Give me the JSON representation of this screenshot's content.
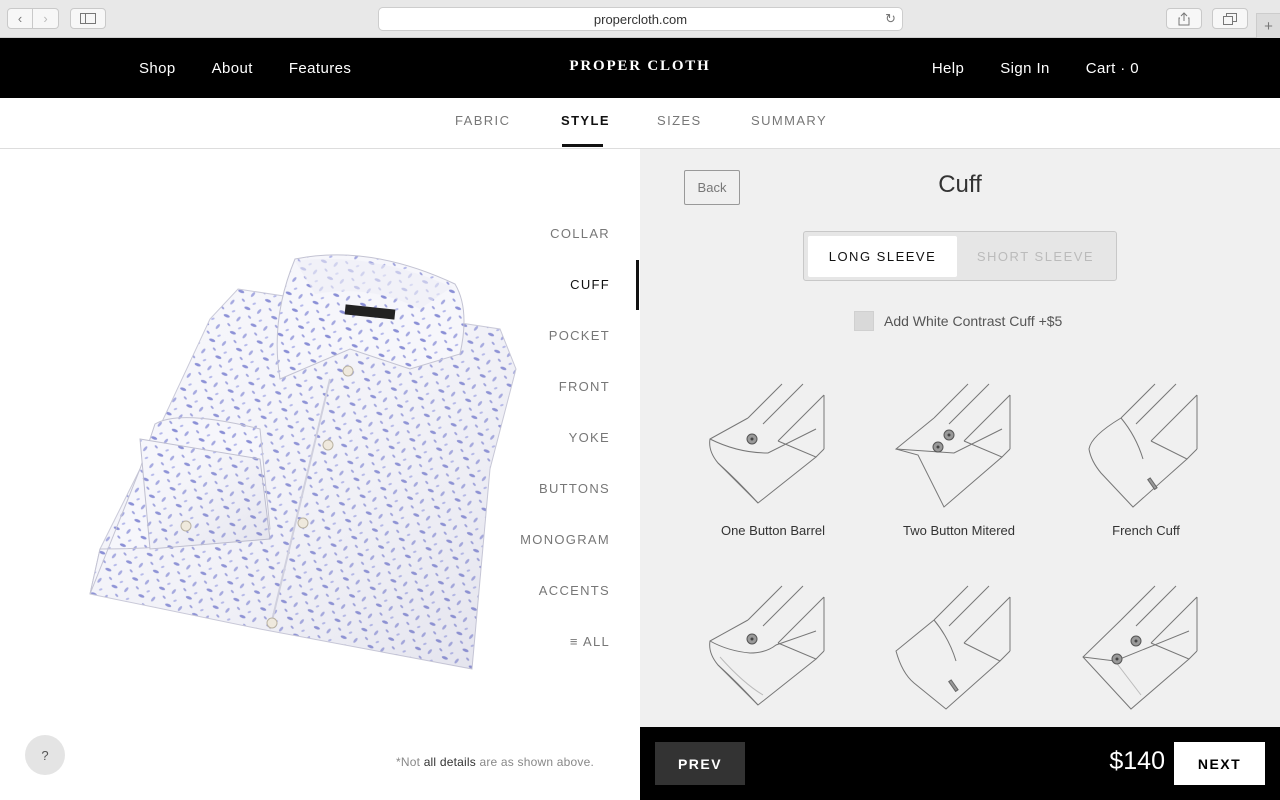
{
  "browser": {
    "url": "propercloth.com"
  },
  "header": {
    "nav_left": [
      "Shop",
      "About",
      "Features"
    ],
    "logo": "PROPER CLOTH",
    "help": "Help",
    "sign_in": "Sign In",
    "cart": "Cart · 0"
  },
  "steps": [
    {
      "label": "FABRIC"
    },
    {
      "label": "STYLE"
    },
    {
      "label": "SIZES"
    },
    {
      "label": "SUMMARY"
    }
  ],
  "style_options": [
    {
      "label": "COLLAR"
    },
    {
      "label": "CUFF"
    },
    {
      "label": "POCKET"
    },
    {
      "label": "FRONT"
    },
    {
      "label": "YOKE"
    },
    {
      "label": "BUTTONS"
    },
    {
      "label": "MONOGRAM"
    },
    {
      "label": "ACCENTS"
    },
    {
      "label": "ALL"
    }
  ],
  "help_button": "?",
  "footnote": {
    "prefix": "*Not ",
    "bold": "all details",
    "suffix": " are as shown above."
  },
  "panel": {
    "back": "Back",
    "title": "Cuff",
    "sleeve_toggle": {
      "long": "LONG SLEEVE",
      "short": "SHORT SLEEVE",
      "selected": "LONG SLEEVE"
    },
    "contrast_option": "Add White Contrast Cuff +$5",
    "cuffs": [
      {
        "label": "One Button Barrel",
        "icon": "one-button-barrel-cuff-icon"
      },
      {
        "label": "Two Button Mitered",
        "icon": "two-button-mitered-cuff-icon"
      },
      {
        "label": "French Cuff",
        "icon": "french-cuff-icon"
      },
      {
        "label": "",
        "icon": "rounded-one-button-cuff-icon"
      },
      {
        "label": "",
        "icon": "french-cuff-alt-icon"
      },
      {
        "label": "",
        "icon": "two-button-barrel-cuff-icon"
      }
    ]
  },
  "footer": {
    "prev": "PREV",
    "price": "$140",
    "next": "NEXT"
  },
  "colors": {
    "header_bg": "#000000",
    "panel_bg": "#f0f0f0",
    "shirt_print": "#8a8fd6"
  }
}
